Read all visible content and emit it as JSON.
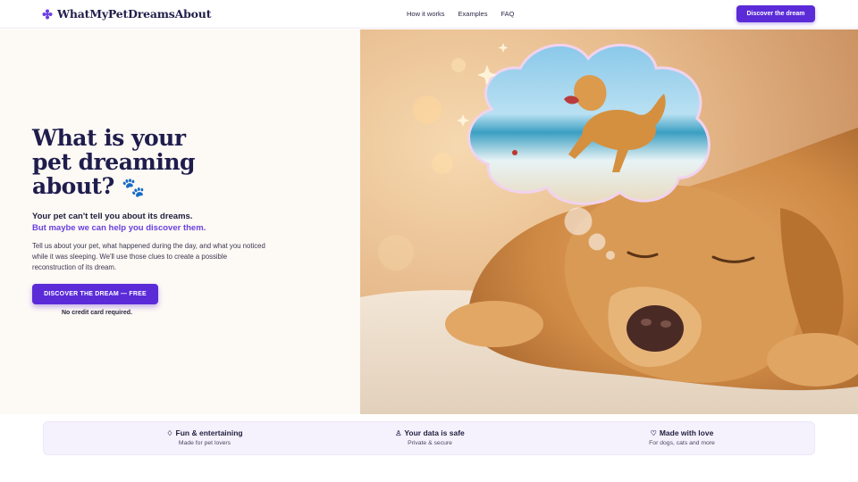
{
  "header": {
    "brand": "WhatMyPetDreamsAbout",
    "logo_icon": "paw-cross-icon",
    "nav": [
      {
        "label": "How it works"
      },
      {
        "label": "Examples"
      },
      {
        "label": "FAQ"
      }
    ],
    "cta_label": "Discover the dream"
  },
  "hero": {
    "title_line1": "What is your",
    "title_line2": "pet dreaming",
    "title_line3": "about?",
    "title_icon": "paw-icon",
    "subtitle_1": "Your pet can't tell you about its dreams.",
    "subtitle_2": "But maybe we can help you discover them.",
    "description": "Tell us about your pet, what happened during the day, and what you noticed while it was sleeping. We'll use those clues to create a possible reconstruction of its dream.",
    "cta_label": "DISCOVER THE DREAM — FREE",
    "note": "No credit card required."
  },
  "features": [
    {
      "icon": "sparkle-icon",
      "title": "Fun & entertaining",
      "subtitle": "Made for pet lovers"
    },
    {
      "icon": "lock-icon",
      "title": "Your data is safe",
      "subtitle": "Private & secure"
    },
    {
      "icon": "heart-icon",
      "title": "Made with love",
      "subtitle": "For dogs, cats and more"
    }
  ],
  "colors": {
    "accent": "#5b2bd8",
    "accent_text": "#6a3fe0",
    "title": "#1f1d4d",
    "hero_bg": "#fdf9f4",
    "features_bg": "#f5f2fe"
  }
}
